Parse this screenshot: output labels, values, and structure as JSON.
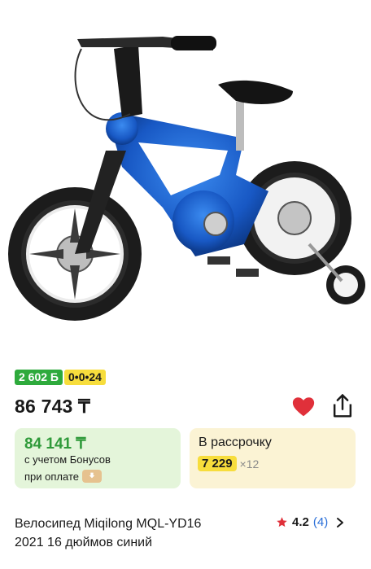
{
  "product": {
    "image_alt_icon": "kids-bicycle-image",
    "bonus_badge": "2 602 Б",
    "installment_badge": "0•0•24",
    "price": "86 743 ₸",
    "title_line1": "Велосипед Miqilong MQL-YD16",
    "title_line2": "2021 16 дюймов синий",
    "rating": "4.2",
    "reviews": "(4)"
  },
  "bonus_card": {
    "price": "84 141 ₸",
    "note_line1": "с учетом Бонусов",
    "note_line2": "при оплате"
  },
  "installment_card": {
    "label": "В рассрочку",
    "amount": "7 229",
    "months": "×12"
  },
  "colors": {
    "accent_green": "#2eaa3c",
    "accent_yellow": "#f7dd3c",
    "heart_red": "#e0303a",
    "link_blue": "#2a6fd8"
  },
  "icons": [
    "heart-icon",
    "share-icon",
    "star-icon",
    "chevron-right-icon",
    "payment-icon"
  ]
}
